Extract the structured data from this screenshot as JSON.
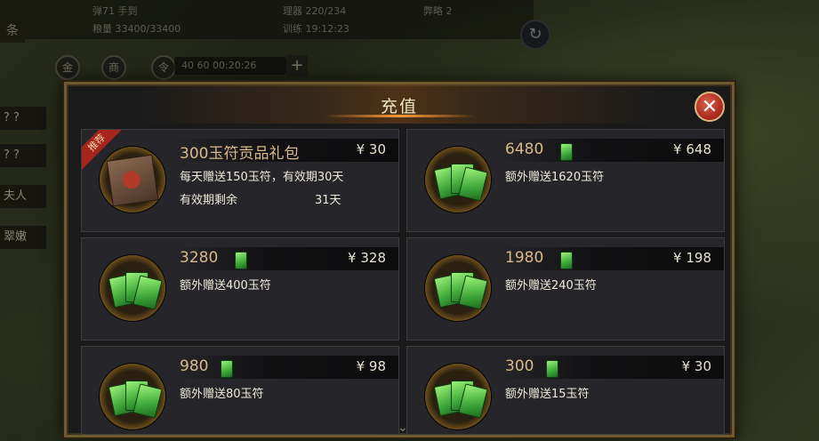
{
  "hud": {
    "line1_left": "弹71 手到",
    "line1_mid": "理器 220/234",
    "line1_right": "弊略 2",
    "line2_left": "粮量 33400/33400",
    "line2_mid": "训练 19:12:23",
    "timer": "40 60 00:20:26",
    "plus": "+",
    "left_tab": "条",
    "round_icons": [
      "金",
      "商",
      "令"
    ],
    "refresh": "↻",
    "side_labels": [
      "? ?",
      "? ?",
      "夫人",
      "翠嫩"
    ]
  },
  "dialog": {
    "title": "充值",
    "close": "✕",
    "scroll_hint": "⌄",
    "cards": [
      {
        "title": "300玉符贡品礼包",
        "price": "¥ 30",
        "line1": "每天赠送150玉符，有效期30天",
        "line2_label": "有效期剩余",
        "line2_value": "31天",
        "ribbon": "推荐",
        "icon": "gift-pack-icon",
        "show_jade_icon": false
      },
      {
        "title": "6480",
        "price": "¥ 648",
        "line1": "额外赠送1620玉符",
        "icon": "jade-tokens-icon",
        "show_jade_icon": true
      },
      {
        "title": "3280",
        "price": "¥ 328",
        "line1": "额外赠送400玉符",
        "icon": "jade-tokens-icon",
        "show_jade_icon": true
      },
      {
        "title": "1980",
        "price": "¥ 198",
        "line1": "额外赠送240玉符",
        "icon": "jade-tokens-icon",
        "show_jade_icon": true
      },
      {
        "title": "980",
        "price": "¥ 98",
        "line1": "额外赠送80玉符",
        "icon": "jade-tokens-icon",
        "show_jade_icon": true
      },
      {
        "title": "300",
        "price": "¥ 30",
        "line1": "额外赠送15玉符",
        "icon": "jade-tokens-icon",
        "show_jade_icon": true
      }
    ]
  },
  "colors": {
    "title_gold": "#d9b98a",
    "frame": "#6e5a2e",
    "close_red": "#a4261c",
    "jade_green": "#3fa83a"
  }
}
